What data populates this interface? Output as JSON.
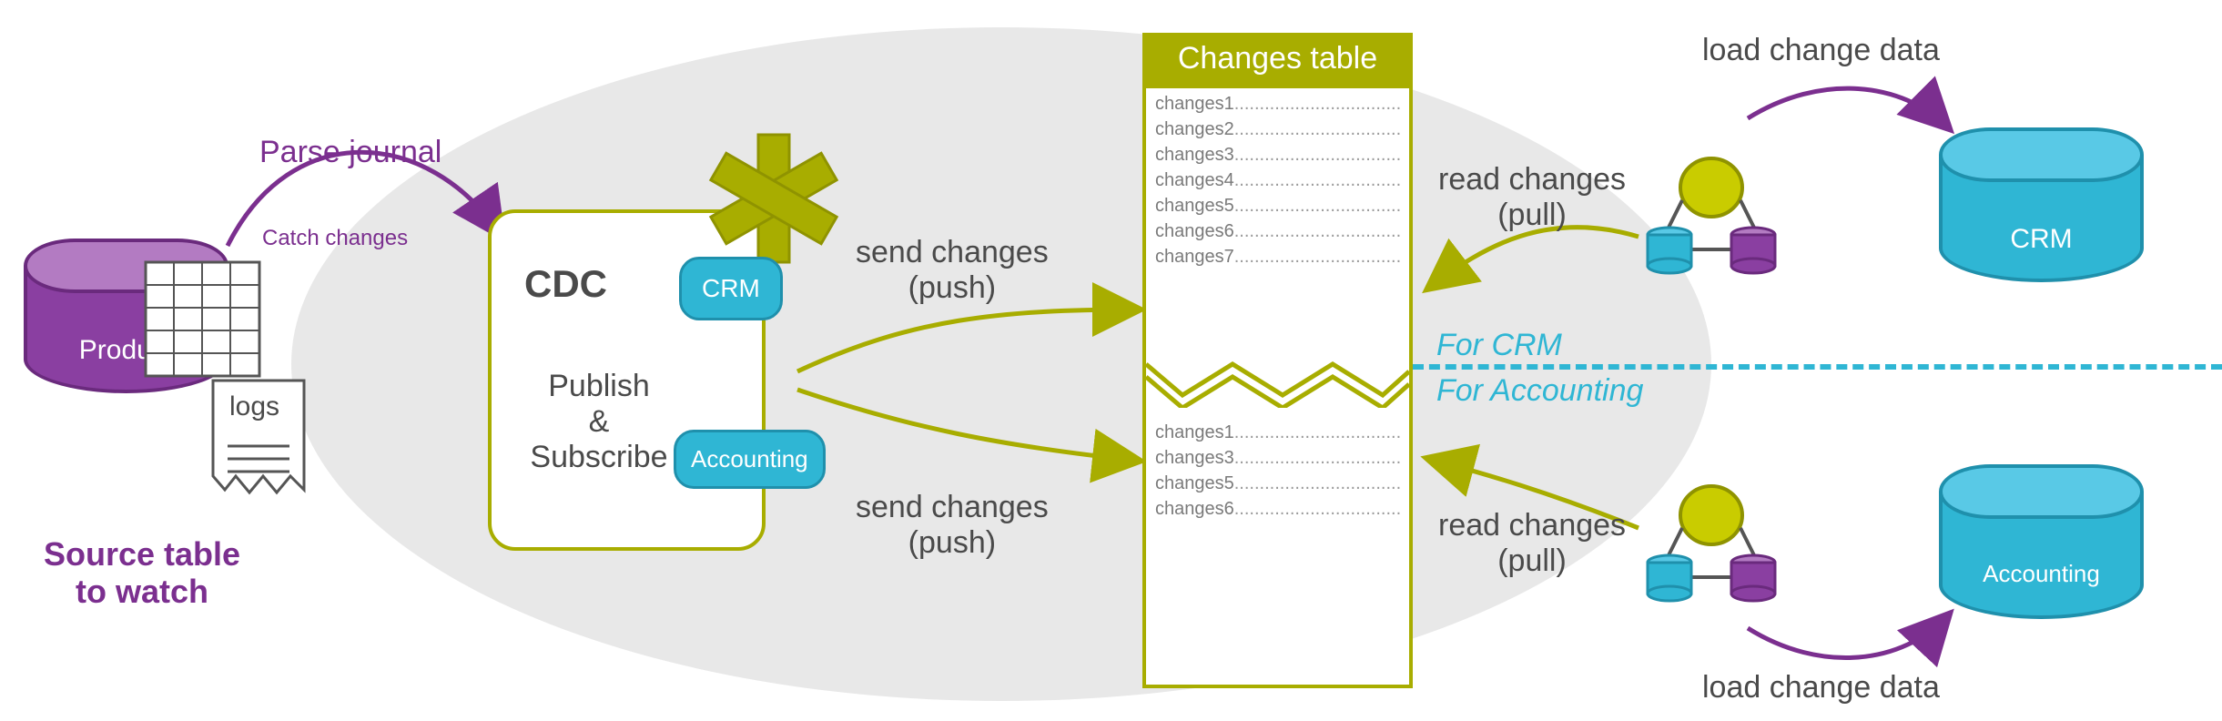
{
  "colors": {
    "olive": "#a8ad00",
    "purple": "#7b2f8f",
    "cyan": "#2fb6d4",
    "gray": "#4a4a4a"
  },
  "source": {
    "db_label": "Product",
    "logs_label": "logs",
    "caption": "Source table\nto watch"
  },
  "arrows": {
    "parse_journal": "Parse journal",
    "catch_changes": "Catch changes",
    "send_push_top": "send changes\n(push)",
    "send_push_bottom": "send changes\n(push)",
    "read_pull_top": "read changes\n(pull)",
    "read_pull_bottom": "read changes\n(pull)",
    "load_top": "load change data",
    "load_bottom": "load change data"
  },
  "cdc": {
    "title": "CDC",
    "subtitle": "Publish\n&\nSubscribe",
    "chip_crm": "CRM",
    "chip_accounting": "Accounting"
  },
  "changes_table": {
    "header": "Changes\ntable",
    "top_rows": [
      "changes1",
      "changes2",
      "changes3",
      "changes4",
      "changes5",
      "changes6",
      "changes7"
    ],
    "bottom_rows": [
      "changes1",
      "changes3",
      "changes5",
      "changes6"
    ]
  },
  "mid_labels": {
    "for_crm": "For CRM",
    "for_accounting": "For Accounting"
  },
  "targets": {
    "crm_label": "CRM",
    "accounting_label": "Accounting"
  }
}
